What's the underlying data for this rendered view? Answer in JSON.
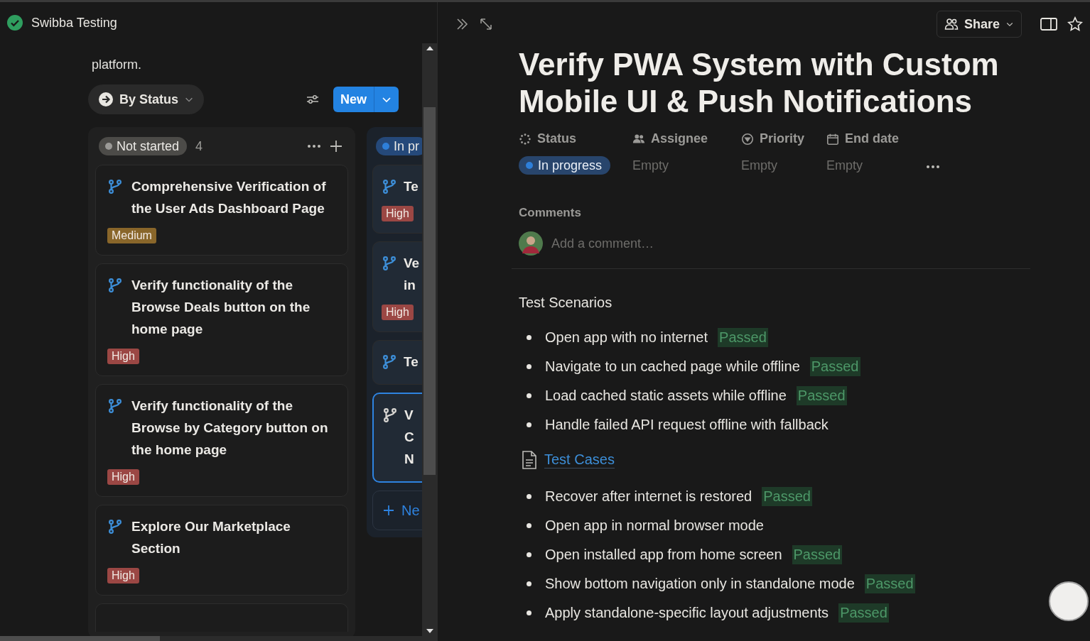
{
  "workspace": {
    "name": "Swibba Testing"
  },
  "description_tail": "platform.",
  "view": {
    "label": "By Status",
    "new_button": "New"
  },
  "board": {
    "columns": [
      {
        "status": "Not started",
        "color": "#9b9a97",
        "count": "4",
        "cards": [
          {
            "title": "Comprehensive Verification of the User Ads Dashboard Page",
            "priority": "Medium",
            "color": "#89662a",
            "selected": false
          },
          {
            "title": "Verify functionality of the Browse Deals button on the home page",
            "priority": "High",
            "color": "#9b4744",
            "selected": false
          },
          {
            "title": "Verify functionality of the Browse by Category button on the home page",
            "priority": "High",
            "color": "#9b4744",
            "selected": false
          },
          {
            "title": "Explore Our Marketplace Section",
            "priority": "High",
            "color": "#9b4744",
            "selected": false
          }
        ]
      },
      {
        "status": "In pr",
        "color": "#2e7fd9",
        "cards": [
          {
            "lines": [
              "Te"
            ],
            "priority": "High",
            "color": "#9b4744",
            "selected": false
          },
          {
            "lines": [
              "Ve",
              "in"
            ],
            "priority": "High",
            "color": "#9b4744",
            "selected": false
          },
          {
            "lines": [
              "Te"
            ],
            "selected": false
          },
          {
            "lines": [
              "V",
              "C",
              "N"
            ],
            "selected": true
          }
        ],
        "add_label": "Ne"
      }
    ]
  },
  "toolbar": {
    "share": "Share"
  },
  "page": {
    "title": "Verify PWA System with Custom Mobile UI & Push Notifications",
    "properties": [
      {
        "kind": "status",
        "label": "Status",
        "value": "In progress",
        "color": "#2e7fd9"
      },
      {
        "kind": "person",
        "label": "Assignee",
        "value": "Empty"
      },
      {
        "kind": "select",
        "label": "Priority",
        "value": "Empty"
      },
      {
        "kind": "date",
        "label": "End date",
        "value": "Empty"
      }
    ],
    "comments": {
      "label": "Comments",
      "placeholder": "Add a comment…"
    },
    "content": [
      {
        "kind": "heading",
        "text": "Test Scenarios"
      },
      {
        "kind": "bullet",
        "text": "Open app with no internet",
        "result": "Passed"
      },
      {
        "kind": "bullet",
        "text": "Navigate to un cached page while offline",
        "result": "Passed"
      },
      {
        "kind": "bullet",
        "text": "Load cached static assets while offline",
        "result": "Passed"
      },
      {
        "kind": "bullet",
        "text": "Handle failed API request offline with fallback"
      },
      {
        "kind": "link",
        "text": "Test Cases"
      },
      {
        "kind": "bullet",
        "text": "Recover after internet is restored",
        "result": "Passed"
      },
      {
        "kind": "bullet",
        "text": "Open app in normal browser mode"
      },
      {
        "kind": "bullet",
        "text": "Open installed app from home screen",
        "result": "Passed"
      },
      {
        "kind": "bullet",
        "text": "Show bottom navigation only in standalone mode",
        "result": "Passed"
      },
      {
        "kind": "bullet",
        "text": "Apply standalone-specific layout adjustments",
        "result": "Passed"
      }
    ]
  }
}
